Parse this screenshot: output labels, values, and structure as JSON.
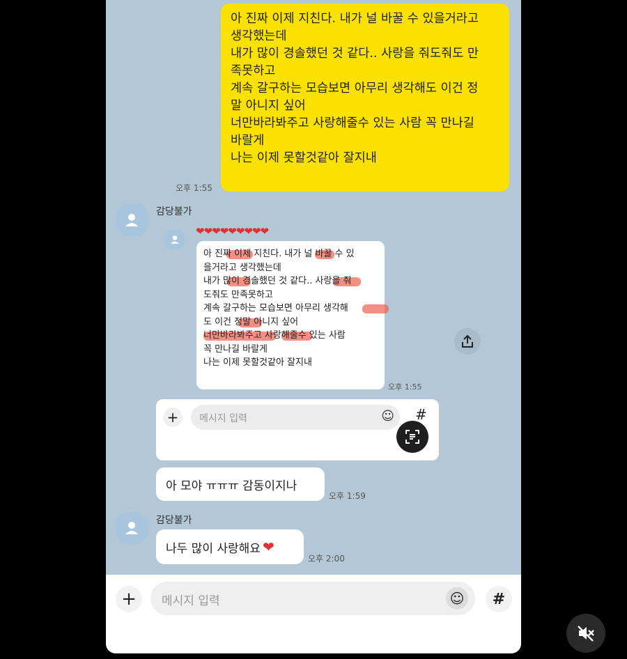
{
  "sent_message": {
    "lines": [
      "아 진짜 이제 지친다. 내가 널 바꿀 수 있을거라고",
      "생각했는데",
      "내가 많이 경솔했던 것 같다.. 사랑을 줘도줘도 만",
      "족못하고",
      "계속 갈구하는 모습보면 아무리 생각해도 이건 정",
      "말 아니지 싶어",
      "너만바라봐주고 사랑해줄수 있는 사람 꼭 만나길",
      "바랄게",
      "나는 이제 못할것같아 잘지내"
    ],
    "time": "오후 1:55"
  },
  "received_1": {
    "sender": "감당불가",
    "hearts": "❤❤❤❤❤❤❤❤❤",
    "quoted_lines": [
      "아 진짜 이제 지친다. 내가 널 바꿀 수 있",
      "을거라고 생각했는데",
      "내가 많이 경솔했던 것 같다.. 사랑을 줘",
      "도줘도 만족못하고",
      "계속 갈구하는 모습보면 아무리 생각해",
      "도 이건 정말 아니지 싶어",
      "너만바라봐주고 사랑해줄수 있는 사람",
      "꼭 만나길 바랄게",
      "나는 이제 못할것같아 잘지내"
    ],
    "quoted_time": "오후 1:55",
    "inner_input_placeholder": "메시지 입력"
  },
  "reply_bubble": {
    "text": "아 모야 ㅠㅠㅠ 감동이지나",
    "time": "오후 1:59"
  },
  "received_2": {
    "sender": "감당불가",
    "text": "나두 많이 사랑해요",
    "heart": "❤",
    "time": "오후 2:00"
  },
  "input_bar": {
    "placeholder": "메시지 입력",
    "plus": "+",
    "hash": "#"
  },
  "colors": {
    "chat_bg": "#b3c7d6",
    "sent_bubble": "#fae100",
    "highlight": "#f05f50"
  }
}
